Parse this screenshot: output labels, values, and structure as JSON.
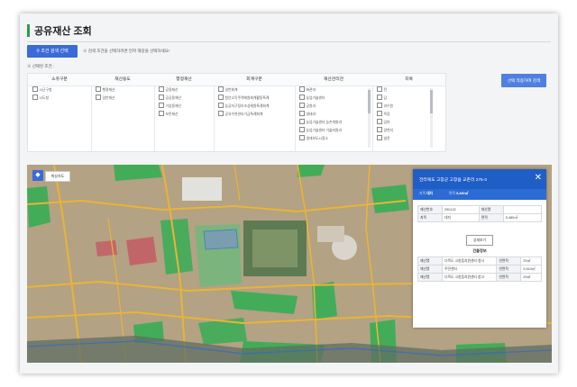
{
  "header": {
    "title": "공유재산 조회"
  },
  "toolbar": {
    "search_label": "조건 검색 선택",
    "search_note": "※ 검색 조건을 선택하려면 먼저 해당을 선택하세요!",
    "selected_label": "※ 선택된 조건 :"
  },
  "filters": {
    "columns": [
      {
        "header": "소유구분",
        "items": [
          "시군구청",
          "시도청"
        ]
      },
      {
        "header": "재산용도",
        "items": [
          "행정재산",
          "일반재산"
        ]
      },
      {
        "header": "행정재산",
        "items": [
          "공용재산",
          "공공용재산",
          "기업용재산",
          "보존재산"
        ]
      },
      {
        "header": "회계구분",
        "items": [
          "일반회계",
          "청년소득주택재원회계활동특례",
          "농공지구정리조성재원특례회계",
          "공유수면관리기금특례회계"
        ]
      },
      {
        "header": "재산관리관",
        "items": [
          "회관과",
          "농업기술센터",
          "공원과",
          "생태과",
          "농업기술센터 농촌개발과",
          "농업기술센터 기술지원과",
          "생애보도시정소"
        ]
      },
      {
        "header": "지목",
        "items": [
          "전",
          "답",
          "과수원",
          "목장",
          "임야",
          "광천지",
          "염전"
        ]
      }
    ],
    "apply_label": "선택 적용하여 검색"
  },
  "map": {
    "layer_label": "위성지도",
    "colors": {
      "green": "#2fae52",
      "red": "#c45a64",
      "road": "#e9b437",
      "blue": "#2b6ad6"
    }
  },
  "panel": {
    "title": "전라북도 고창군 고창읍 교촌리 275-3",
    "sub": {
      "k1": "지목",
      "v1": "대지",
      "k2": "면적",
      "v2": "5,480㎡"
    },
    "info_rows": [
      {
        "k": "재산번호",
        "v": "290122",
        "k2": "재산명",
        "v2": ""
      },
      {
        "k": "지목",
        "v": "대지",
        "k2": "면적",
        "v2": "5,480㎡"
      }
    ],
    "detail_btn": "상세보기",
    "section_label": "건물정보",
    "building_rows": [
      {
        "k": "재산명",
        "v": "다목도 고창읍지원센터 청사",
        "k2": "연면적",
        "v2": "25㎡"
      },
      {
        "k": "재산명",
        "v": "주민센터",
        "k2": "연면적",
        "v2": "5,610㎡"
      },
      {
        "k": "재산명",
        "v": "다목도 고창읍지원센터 창고",
        "k2": "연면적",
        "v2": "25㎡"
      }
    ]
  }
}
